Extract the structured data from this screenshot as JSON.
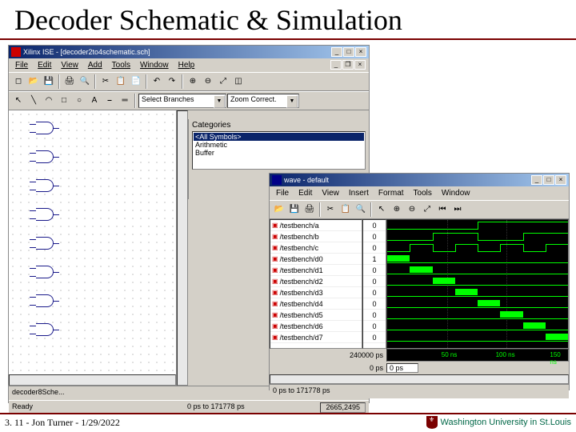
{
  "slide": {
    "title": "Decoder Schematic & Simulation"
  },
  "sch": {
    "titlebar": "Xilinx ISE - [decoder2to4schematic.sch]",
    "menu": [
      "File",
      "Edit",
      "View",
      "Add",
      "Tools",
      "Window",
      "Help"
    ],
    "combo1": "Select Branches",
    "tb_btn_zoom": "Zoom Correct.",
    "tab": "decoder8Sche...",
    "status": "Ready",
    "coord": "2665,2495",
    "categories_label": "Categories",
    "categories": [
      "<All Symbols>",
      "Arithmetic",
      "Buffer"
    ],
    "footer_range": "0 ps to 171778 ps"
  },
  "wave": {
    "titlebar": "wave - default",
    "menu": [
      "File",
      "Edit",
      "View",
      "Insert",
      "Format",
      "Tools",
      "Window"
    ],
    "signals": [
      {
        "name": "/testbench/a",
        "val": "0"
      },
      {
        "name": "/testbench/b",
        "val": "0"
      },
      {
        "name": "/testbench/c",
        "val": "0"
      },
      {
        "name": "/testbench/d0",
        "val": "1"
      },
      {
        "name": "/testbench/d1",
        "val": "0"
      },
      {
        "name": "/testbench/d2",
        "val": "0"
      },
      {
        "name": "/testbench/d3",
        "val": "0"
      },
      {
        "name": "/testbench/d4",
        "val": "0"
      },
      {
        "name": "/testbench/d5",
        "val": "0"
      },
      {
        "name": "/testbench/d6",
        "val": "0"
      },
      {
        "name": "/testbench/d7",
        "val": "0"
      }
    ],
    "time_val": "240000 ps",
    "cursor_time": "0 ps",
    "cursor_field": "0 ps",
    "ruler": [
      "50 ns",
      "100 ns",
      "150 ns"
    ],
    "status_range": "0 ps to 171778 ps"
  },
  "footer": {
    "text": "3. 11 - Jon Turner - 1/29/2022",
    "logo": "Washington University in St.Louis"
  },
  "chart_data": {
    "type": "table",
    "description": "Waveform values for 3-to-8 decoder simulation over 0-160ns",
    "time_axis_ns": [
      0,
      50,
      100,
      150
    ],
    "signals": {
      "a": {
        "toggles_at_ns": [
          80
        ],
        "initial": 0
      },
      "b": {
        "toggles_at_ns": [
          40,
          80,
          120
        ],
        "initial": 0
      },
      "c": {
        "toggles_at_ns": [
          20,
          40,
          60,
          80,
          100,
          120,
          140
        ],
        "initial": 0
      },
      "d0": {
        "high_intervals_ns": [
          [
            0,
            20
          ]
        ]
      },
      "d1": {
        "high_intervals_ns": [
          [
            20,
            40
          ]
        ]
      },
      "d2": {
        "high_intervals_ns": [
          [
            40,
            60
          ]
        ]
      },
      "d3": {
        "high_intervals_ns": [
          [
            60,
            80
          ]
        ]
      },
      "d4": {
        "high_intervals_ns": [
          [
            80,
            100
          ]
        ]
      },
      "d5": {
        "high_intervals_ns": [
          [
            100,
            120
          ]
        ]
      },
      "d6": {
        "high_intervals_ns": [
          [
            120,
            140
          ]
        ]
      },
      "d7": {
        "high_intervals_ns": [
          [
            140,
            160
          ]
        ]
      }
    }
  }
}
